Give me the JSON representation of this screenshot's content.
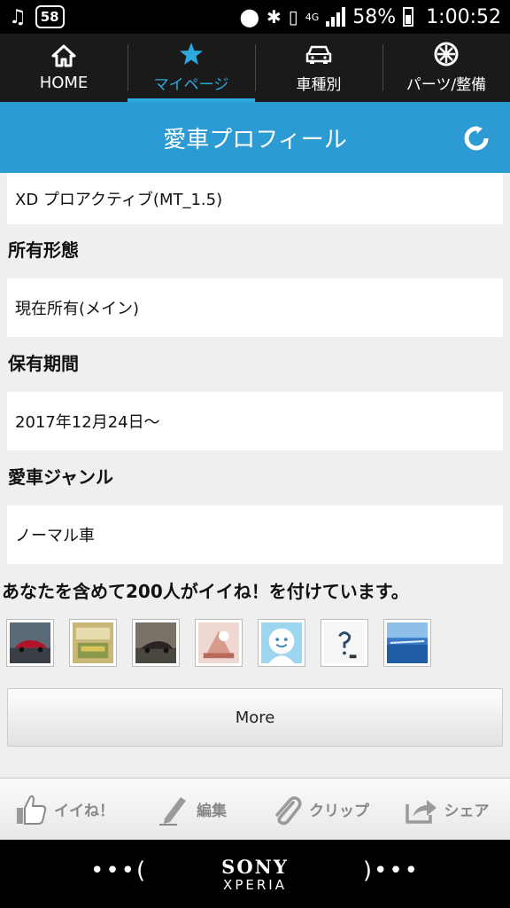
{
  "status_bar": {
    "notification_count": "58",
    "network": "4G",
    "battery": "58%",
    "time": "1:00:52"
  },
  "tabs": [
    {
      "label": "HOME",
      "icon": "home-icon"
    },
    {
      "label": "マイページ",
      "icon": "star-icon"
    },
    {
      "label": "車種別",
      "icon": "car-icon"
    },
    {
      "label": "パーツ/整備",
      "icon": "wheel-icon"
    }
  ],
  "header": {
    "title": "愛車プロフィール"
  },
  "profile": {
    "grade_value": "XD プロアクティブ(MT_1.5)",
    "ownership_label": "所有形態",
    "ownership_value": "現在所有(メイン)",
    "period_label": "保有期間",
    "period_value": "2017年12月24日～",
    "genre_label": "愛車ジャンル",
    "genre_value": "ノーマル車"
  },
  "likes": {
    "text": "あなたを含めて200人がイイね！を付けています。",
    "more_label": "More"
  },
  "actions": [
    {
      "label": "イイね！",
      "icon": "thumbs-up-icon"
    },
    {
      "label": "編集",
      "icon": "pen-icon"
    },
    {
      "label": "クリップ",
      "icon": "paperclip-icon"
    },
    {
      "label": "シェア",
      "icon": "share-icon"
    }
  ],
  "navbar": {
    "brand": "SONY",
    "model": "XPERIA",
    "left": "•••(",
    "right": ")•••"
  },
  "colors": {
    "accent": "#2c9ad3",
    "active_tab": "#2ea6de",
    "tabbar_bg": "#1a1a1a"
  }
}
